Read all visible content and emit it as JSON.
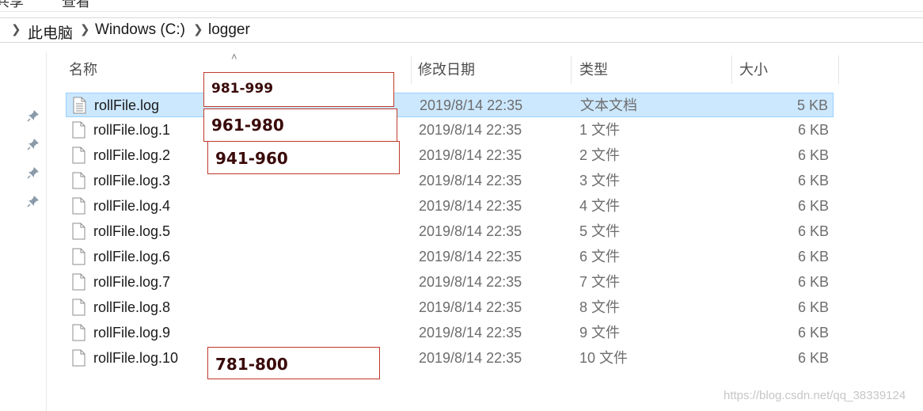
{
  "title_fragments": [
    "共享",
    "查看"
  ],
  "breadcrumb": {
    "items": [
      "此电脑",
      "Windows (C:)",
      "logger"
    ]
  },
  "columns": {
    "name": "名称",
    "date": "修改日期",
    "type": "类型",
    "size": "大小"
  },
  "files": [
    {
      "name": "rollFile.log",
      "date": "2019/8/14 22:35",
      "type": "文本文档",
      "size": "5 KB",
      "selected": true
    },
    {
      "name": "rollFile.log.1",
      "date": "2019/8/14 22:35",
      "type": "1 文件",
      "size": "6 KB"
    },
    {
      "name": "rollFile.log.2",
      "date": "2019/8/14 22:35",
      "type": "2 文件",
      "size": "6 KB"
    },
    {
      "name": "rollFile.log.3",
      "date": "2019/8/14 22:35",
      "type": "3 文件",
      "size": "6 KB"
    },
    {
      "name": "rollFile.log.4",
      "date": "2019/8/14 22:35",
      "type": "4 文件",
      "size": "6 KB"
    },
    {
      "name": "rollFile.log.5",
      "date": "2019/8/14 22:35",
      "type": "5 文件",
      "size": "6 KB"
    },
    {
      "name": "rollFile.log.6",
      "date": "2019/8/14 22:35",
      "type": "6 文件",
      "size": "6 KB"
    },
    {
      "name": "rollFile.log.7",
      "date": "2019/8/14 22:35",
      "type": "7 文件",
      "size": "6 KB"
    },
    {
      "name": "rollFile.log.8",
      "date": "2019/8/14 22:35",
      "type": "8 文件",
      "size": "6 KB"
    },
    {
      "name": "rollFile.log.9",
      "date": "2019/8/14 22:35",
      "type": "9 文件",
      "size": "6 KB"
    },
    {
      "name": "rollFile.log.10",
      "date": "2019/8/14 22:35",
      "type": "10 文件",
      "size": "6 KB"
    }
  ],
  "annotations": [
    "981-999",
    "961-980",
    "941-960",
    "781-800"
  ],
  "watermark": "https://blog.csdn.net/qq_38339124",
  "colors": {
    "selection_bg": "#cce8ff",
    "selection_border": "#99d1ff",
    "annotation_border": "#c0392b"
  }
}
